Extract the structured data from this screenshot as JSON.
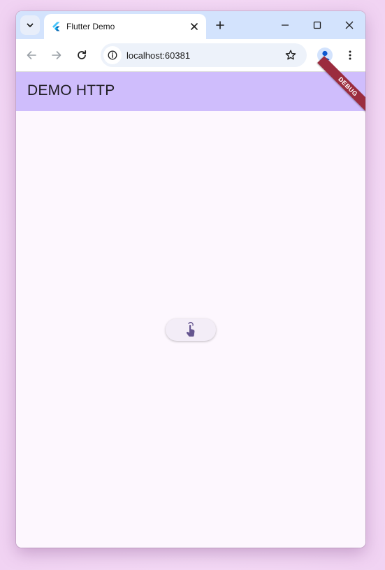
{
  "browser": {
    "tab_title": "Flutter Demo",
    "url": "localhost:60381",
    "icons": {
      "tab_search": "chevron-down-icon",
      "favicon": "flutter-logo-icon",
      "tab_close": "close-icon",
      "new_tab": "plus-icon",
      "minimize": "minimize-icon",
      "maximize": "maximize-icon",
      "close_window": "close-icon",
      "back": "arrow-left-icon",
      "forward": "arrow-right-icon",
      "reload": "reload-icon",
      "site_info": "info-icon",
      "bookmark": "star-icon",
      "profile": "person-icon",
      "menu": "more-vert-icon"
    }
  },
  "app": {
    "title": "DEMO HTTP",
    "debug_banner": "DEBUG",
    "button_icon": "touch-app-icon",
    "colors": {
      "appbar": "#cfbdfc",
      "background": "#fdf7fe",
      "button_icon": "#65558f",
      "debug_banner": "#9b2c3e"
    }
  }
}
